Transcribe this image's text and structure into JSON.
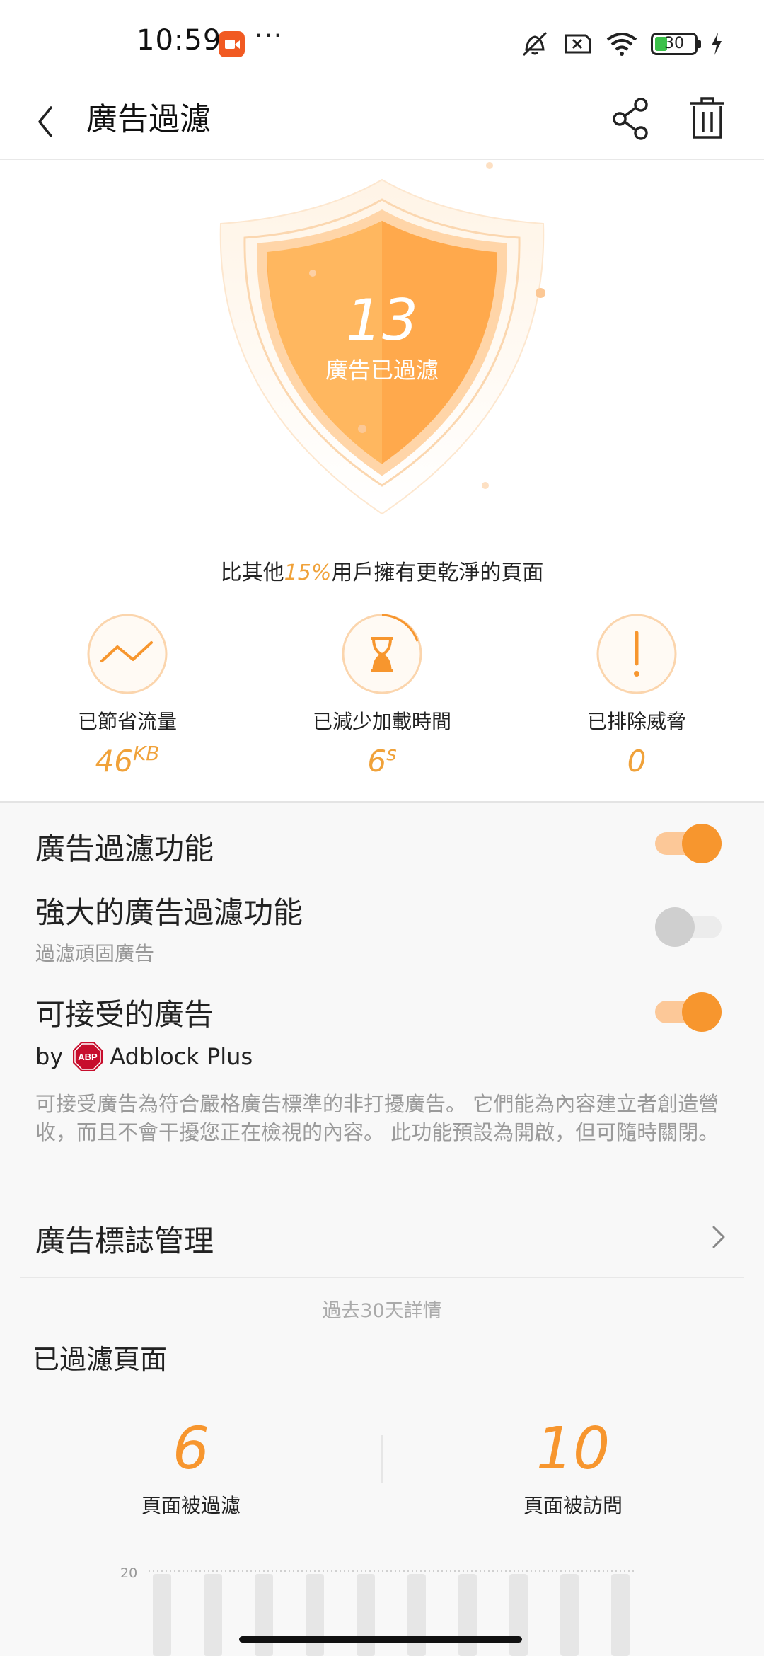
{
  "status_bar": {
    "time": "10:59",
    "more": "···",
    "battery": "30",
    "icons": [
      "recorder-app-icon",
      "mute-icon",
      "no-sim-icon",
      "wifi-icon",
      "battery-icon",
      "charging-icon"
    ]
  },
  "header": {
    "title": "廣告過濾",
    "back_icon": "back-icon",
    "share_icon": "share-icon",
    "delete_icon": "trash-icon"
  },
  "hero": {
    "count": "13",
    "count_label": "廣告已過濾",
    "compare_prefix": "比其他",
    "compare_percent": "15%",
    "compare_suffix": "用戶擁有更乾淨的頁面",
    "accent_color": "#f7962e"
  },
  "stats": [
    {
      "label": "已節省流量",
      "value": "46",
      "unit": "KB",
      "icon": "trend-line-icon"
    },
    {
      "label": "已減少加載時間",
      "value": "6",
      "unit": "s",
      "icon": "hourglass-icon"
    },
    {
      "label": "已排除威脅",
      "value": "0",
      "unit": "",
      "icon": "exclamation-icon"
    }
  ],
  "settings": {
    "ad_filter": {
      "title": "廣告過濾功能",
      "enabled": true
    },
    "strong_filter": {
      "title": "強大的廣告過濾功能",
      "subtitle": "過濾頑固廣告",
      "enabled": false
    },
    "acceptable_ads": {
      "title": "可接受的廣告",
      "enabled": true,
      "by": "by",
      "provider": "Adblock Plus",
      "logo_text": "ABP",
      "description": "可接受廣告為符合嚴格廣告標準的非打擾廣告。 它們能為內容建立者創造營收，而且不會干擾您正在檢視的內容。 此功能預設為開啟，但可隨時關閉。"
    },
    "ad_badge": {
      "title": "廣告標誌管理"
    }
  },
  "details": {
    "period": "過去30天詳情",
    "section_title": "已過濾頁面",
    "filtered": {
      "value": "6",
      "label": "頁面被過濾"
    },
    "visited": {
      "value": "10",
      "label": "頁面被訪問"
    }
  },
  "chart_data": {
    "type": "bar",
    "ytick_top": "20",
    "ylim": [
      0,
      20
    ],
    "bar_count": 10,
    "grid": true
  }
}
